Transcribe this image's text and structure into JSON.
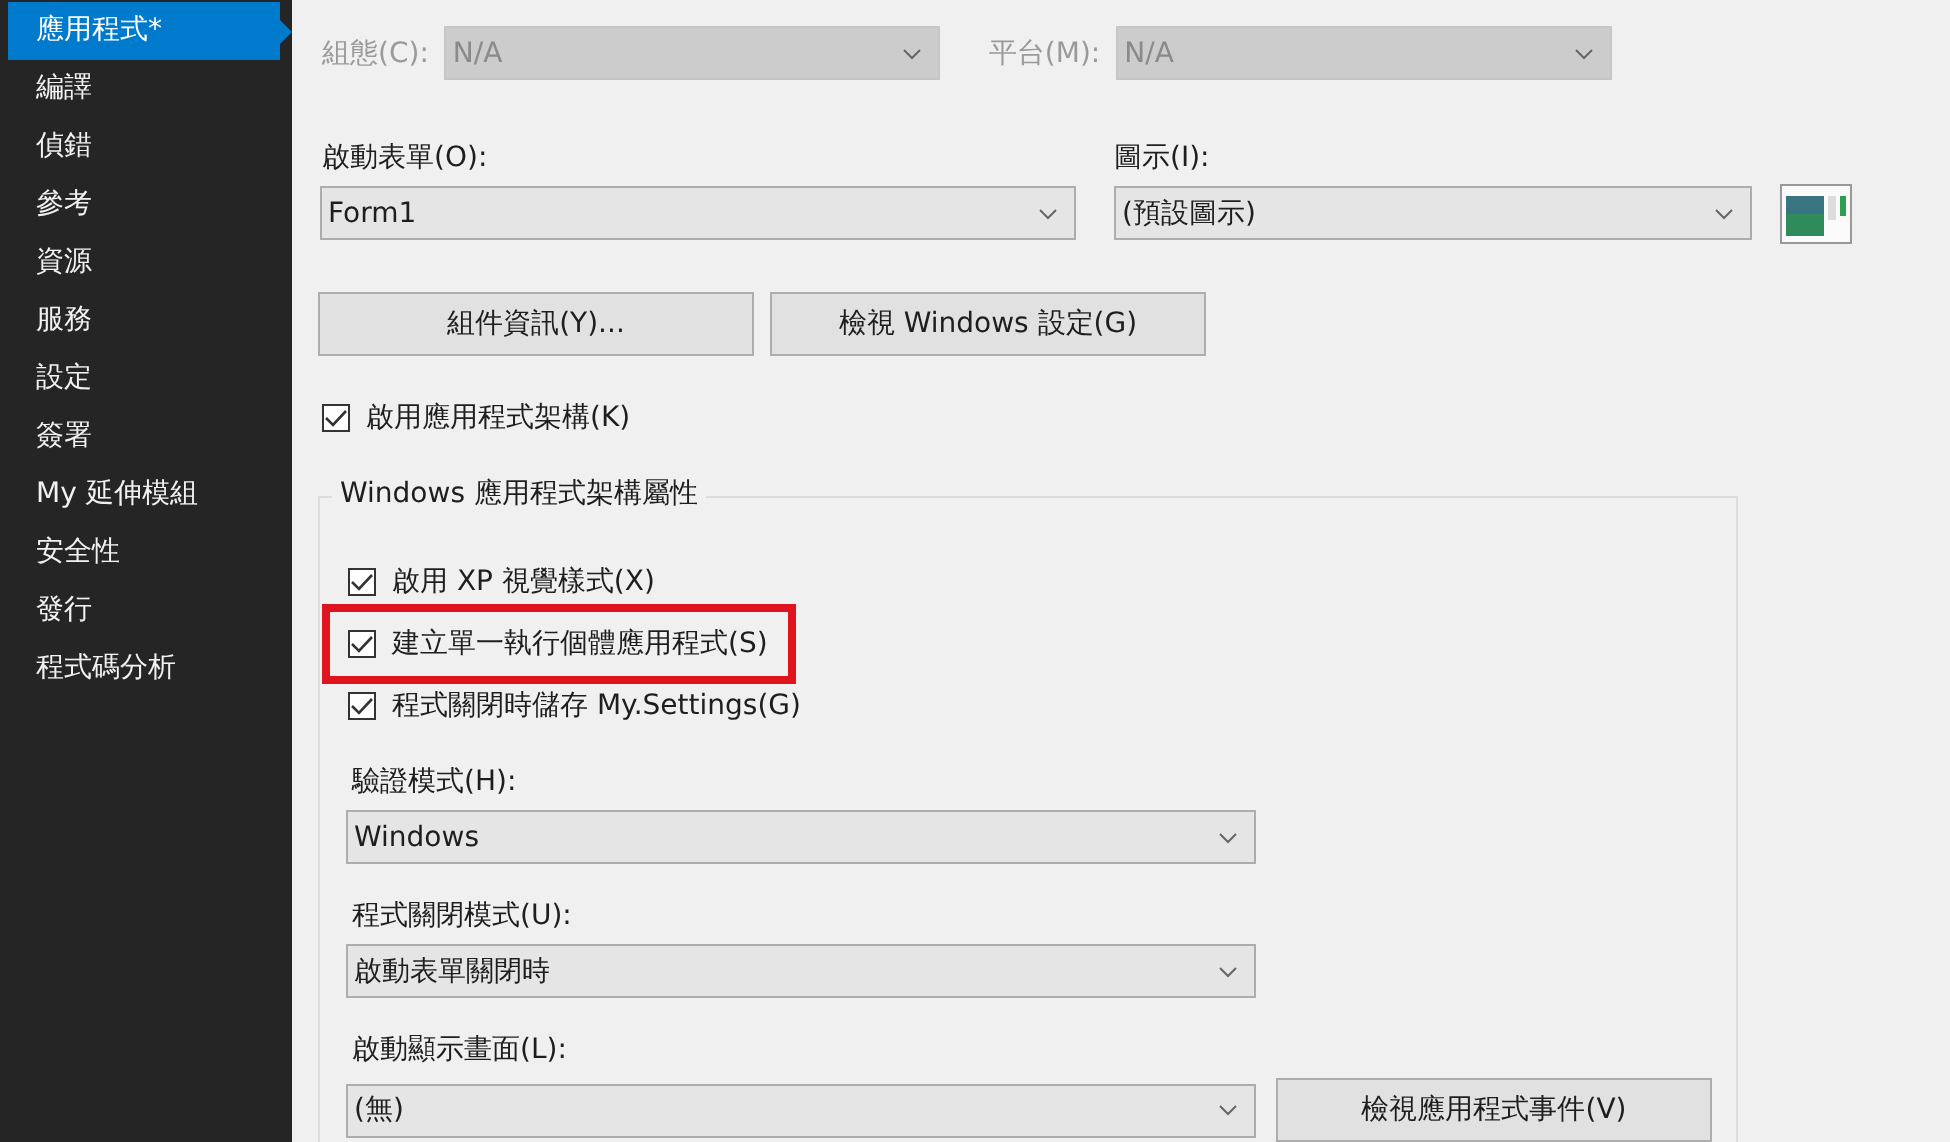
{
  "sidebar": {
    "items": [
      {
        "label": "應用程式*",
        "selected": true
      },
      {
        "label": "編譯",
        "selected": false
      },
      {
        "label": "偵錯",
        "selected": false
      },
      {
        "label": "參考",
        "selected": false
      },
      {
        "label": "資源",
        "selected": false
      },
      {
        "label": "服務",
        "selected": false
      },
      {
        "label": "設定",
        "selected": false
      },
      {
        "label": "簽署",
        "selected": false
      },
      {
        "label": "My 延伸模組",
        "selected": false
      },
      {
        "label": "安全性",
        "selected": false
      },
      {
        "label": "發行",
        "selected": false
      },
      {
        "label": "程式碼分析",
        "selected": false
      }
    ]
  },
  "top_row": [
    {
      "label": "組態(C):",
      "value": "N/A",
      "disabled": true
    },
    {
      "label": "平台(M):",
      "value": "N/A",
      "disabled": true
    }
  ],
  "startup_form": {
    "label": "啟動表單(O):",
    "value": "Form1"
  },
  "icon_field": {
    "label": "圖示(I):",
    "value": "(預設圖示)"
  },
  "buttons": [
    "組件資訊(Y)...",
    "檢視 Windows 設定(G)"
  ],
  "enable_framework": {
    "label": "啟用應用程式架構(K)",
    "checked": true
  },
  "framework_group": {
    "title": "Windows 應用程式架構屬性",
    "checkboxes": [
      {
        "label": "啟用 XP 視覺樣式(X)",
        "checked": true,
        "highlighted": false
      },
      {
        "label": "建立單一執行個體應用程式(S)",
        "checked": true,
        "highlighted": true
      },
      {
        "label": "程式關閉時儲存 My.Settings(G)",
        "checked": true,
        "highlighted": false
      }
    ],
    "dropdowns": [
      {
        "label": "驗證模式(H):",
        "value": "Windows"
      },
      {
        "label": "程式關閉模式(U):",
        "value": "啟動表單關閉時"
      },
      {
        "label": "啟動顯示畫面(L):",
        "value": "(無)"
      }
    ],
    "events_button": "檢視應用程式事件(V)"
  }
}
